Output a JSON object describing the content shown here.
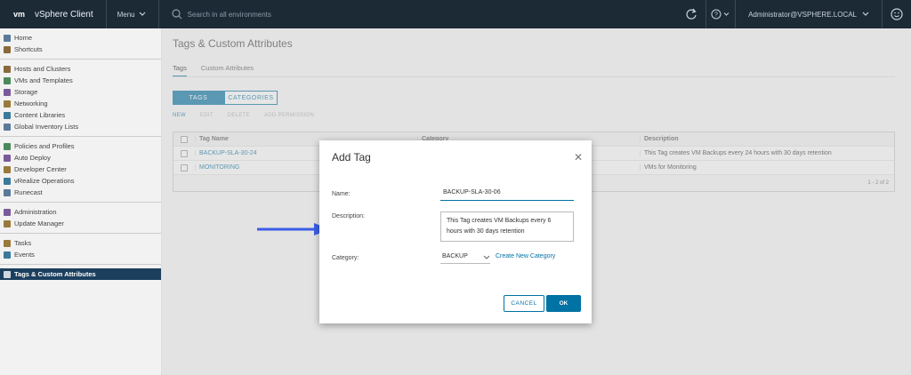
{
  "header": {
    "logo": "vm",
    "app_title": "vSphere Client",
    "menu_label": "Menu",
    "search_placeholder": "Search in all environments",
    "user": "Administrator@VSPHERE.LOCAL"
  },
  "sidebar": {
    "groups": [
      [
        {
          "label": "Home",
          "icon": "home-icon"
        },
        {
          "label": "Shortcuts",
          "icon": "shortcuts-icon"
        }
      ],
      [
        {
          "label": "Hosts and Clusters",
          "icon": "hosts-icon"
        },
        {
          "label": "VMs and Templates",
          "icon": "vms-icon"
        },
        {
          "label": "Storage",
          "icon": "storage-icon"
        },
        {
          "label": "Networking",
          "icon": "network-icon"
        },
        {
          "label": "Content Libraries",
          "icon": "library-icon"
        },
        {
          "label": "Global Inventory Lists",
          "icon": "inventory-icon"
        }
      ],
      [
        {
          "label": "Policies and Profiles",
          "icon": "policies-icon"
        },
        {
          "label": "Auto Deploy",
          "icon": "deploy-icon"
        },
        {
          "label": "Developer Center",
          "icon": "developer-icon"
        },
        {
          "label": "vRealize Operations",
          "icon": "vrops-icon"
        },
        {
          "label": "Runecast",
          "icon": "runecast-icon"
        }
      ],
      [
        {
          "label": "Administration",
          "icon": "admin-icon"
        },
        {
          "label": "Update Manager",
          "icon": "update-icon"
        }
      ],
      [
        {
          "label": "Tasks",
          "icon": "tasks-icon"
        },
        {
          "label": "Events",
          "icon": "events-icon"
        }
      ]
    ],
    "active": {
      "label": "Tags & Custom Attributes",
      "icon": "tag-icon"
    }
  },
  "main": {
    "title": "Tags & Custom Attributes",
    "tabs": [
      "Tags",
      "Custom Attributes"
    ],
    "segments": [
      "TAGS",
      "CATEGORIES"
    ],
    "actions": [
      "NEW",
      "EDIT",
      "DELETE",
      "ADD PERMISSION"
    ],
    "columns": [
      "Tag Name",
      "Category",
      "Description"
    ],
    "rows": [
      {
        "name": "BACKUP-SLA-30-24",
        "category": "",
        "description": "This Tag creates VM Backups every 24 hours with 30 days retention"
      },
      {
        "name": "MONITORING",
        "category": "",
        "description": "VMs for Monitoring"
      }
    ],
    "footer": "1 - 2 of 2"
  },
  "dialog": {
    "title": "Add Tag",
    "name_label": "Name:",
    "name_value": "BACKUP-SLA-30-06",
    "desc_label": "Description:",
    "desc_value": "This Tag creates VM Backups every 6 hours with 30 days retention",
    "cat_label": "Category:",
    "cat_value": "BACKUP",
    "create_link": "Create New Category",
    "cancel": "CANCEL",
    "ok": "OK"
  }
}
